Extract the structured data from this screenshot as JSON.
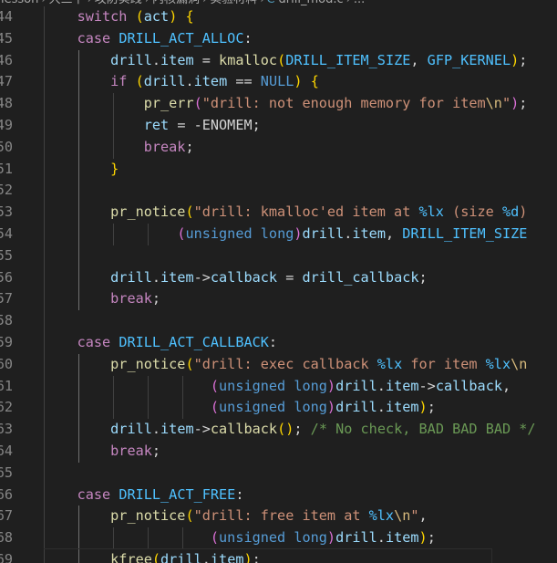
{
  "breadcrumb": [
    "lesson",
    "大三下",
    "攻防实践",
    "内核漏洞",
    "实验材料",
    "drill_mod.c",
    "..."
  ],
  "lines": [
    {
      "n": "44",
      "g": 1,
      "t": [
        [
          "",
          "    "
        ],
        [
          "ctl",
          "switch"
        ],
        [
          "pl",
          " "
        ],
        [
          "p1",
          "("
        ],
        [
          "var",
          "act"
        ],
        [
          "p1",
          ")"
        ],
        [
          "pl",
          " "
        ],
        [
          "p1",
          "{"
        ]
      ]
    },
    {
      "n": "45",
      "g": 1,
      "t": [
        [
          "",
          "    "
        ],
        [
          "ctl",
          "case"
        ],
        [
          "pl",
          " "
        ],
        [
          "mac",
          "DRILL_ACT_ALLOC"
        ],
        [
          "pl",
          ":"
        ]
      ]
    },
    {
      "n": "46",
      "g": 2,
      "t": [
        [
          "",
          "        "
        ],
        [
          "var",
          "drill"
        ],
        [
          "pl",
          "."
        ],
        [
          "var",
          "item"
        ],
        [
          "pl",
          " = "
        ],
        [
          "fn",
          "kmalloc"
        ],
        [
          "p1",
          "("
        ],
        [
          "mac",
          "DRILL_ITEM_SIZE"
        ],
        [
          "pl",
          ", "
        ],
        [
          "mac",
          "GFP_KERNEL"
        ],
        [
          "p1",
          ")"
        ],
        [
          "pl",
          ";"
        ]
      ]
    },
    {
      "n": "47",
      "g": 2,
      "t": [
        [
          "",
          "        "
        ],
        [
          "ctl",
          "if"
        ],
        [
          "pl",
          " "
        ],
        [
          "p1",
          "("
        ],
        [
          "var",
          "drill"
        ],
        [
          "pl",
          "."
        ],
        [
          "var",
          "item"
        ],
        [
          "pl",
          " == "
        ],
        [
          "kw",
          "NULL"
        ],
        [
          "p1",
          ")"
        ],
        [
          "pl",
          " "
        ],
        [
          "p1",
          "{"
        ]
      ]
    },
    {
      "n": "48",
      "g": 3,
      "t": [
        [
          "",
          "            "
        ],
        [
          "fn",
          "pr_err"
        ],
        [
          "p2",
          "("
        ],
        [
          "str",
          "\"drill: not enough memory for item"
        ],
        [
          "esc",
          "\\n"
        ],
        [
          "str",
          "\""
        ],
        [
          "p2",
          ")"
        ],
        [
          "pl",
          ";"
        ]
      ]
    },
    {
      "n": "49",
      "g": 3,
      "t": [
        [
          "",
          "            "
        ],
        [
          "var",
          "ret"
        ],
        [
          "pl",
          " = -ENOMEM;"
        ]
      ]
    },
    {
      "n": "50",
      "g": 3,
      "t": [
        [
          "",
          "            "
        ],
        [
          "ctl",
          "break"
        ],
        [
          "pl",
          ";"
        ]
      ]
    },
    {
      "n": "51",
      "g": 2,
      "t": [
        [
          "",
          "        "
        ],
        [
          "p1",
          "}"
        ]
      ]
    },
    {
      "n": "52",
      "g": 2,
      "t": [
        [
          "",
          ""
        ]
      ]
    },
    {
      "n": "53",
      "g": 2,
      "t": [
        [
          "",
          "        "
        ],
        [
          "fn",
          "pr_notice"
        ],
        [
          "p1",
          "("
        ],
        [
          "str",
          "\"drill: kmalloc'ed item at "
        ],
        [
          "mac",
          "%lx"
        ],
        [
          "str",
          " (size "
        ],
        [
          "mac",
          "%d"
        ],
        [
          "str",
          ")"
        ]
      ]
    },
    {
      "n": "54",
      "g": 4,
      "t": [
        [
          "",
          "                "
        ],
        [
          "p2",
          "("
        ],
        [
          "kw",
          "unsigned"
        ],
        [
          "pl",
          " "
        ],
        [
          "kw",
          "long"
        ],
        [
          "p2",
          ")"
        ],
        [
          "var",
          "drill"
        ],
        [
          "pl",
          "."
        ],
        [
          "var",
          "item"
        ],
        [
          "pl",
          ", "
        ],
        [
          "mac",
          "DRILL_ITEM_SIZE"
        ]
      ]
    },
    {
      "n": "55",
      "g": 2,
      "t": [
        [
          "",
          ""
        ]
      ]
    },
    {
      "n": "56",
      "g": 2,
      "t": [
        [
          "",
          "        "
        ],
        [
          "var",
          "drill"
        ],
        [
          "pl",
          "."
        ],
        [
          "var",
          "item"
        ],
        [
          "pl",
          "->"
        ],
        [
          "var",
          "callback"
        ],
        [
          "pl",
          " = "
        ],
        [
          "var",
          "drill_callback"
        ],
        [
          "pl",
          ";"
        ]
      ]
    },
    {
      "n": "57",
      "g": 2,
      "t": [
        [
          "",
          "        "
        ],
        [
          "ctl",
          "break"
        ],
        [
          "pl",
          ";"
        ]
      ]
    },
    {
      "n": "58",
      "g": 1,
      "t": [
        [
          "",
          ""
        ]
      ]
    },
    {
      "n": "59",
      "g": 1,
      "t": [
        [
          "",
          "    "
        ],
        [
          "ctl",
          "case"
        ],
        [
          "pl",
          " "
        ],
        [
          "mac",
          "DRILL_ACT_CALLBACK"
        ],
        [
          "pl",
          ":"
        ]
      ]
    },
    {
      "n": "60",
      "g": 2,
      "t": [
        [
          "",
          "        "
        ],
        [
          "fn",
          "pr_notice"
        ],
        [
          "p1",
          "("
        ],
        [
          "str",
          "\"drill: exec callback "
        ],
        [
          "mac",
          "%lx"
        ],
        [
          "str",
          " for item "
        ],
        [
          "mac",
          "%lx"
        ],
        [
          "esc",
          "\\n"
        ]
      ]
    },
    {
      "n": "61",
      "g": 5,
      "t": [
        [
          "",
          "                    "
        ],
        [
          "p2",
          "("
        ],
        [
          "kw",
          "unsigned"
        ],
        [
          "pl",
          " "
        ],
        [
          "kw",
          "long"
        ],
        [
          "p2",
          ")"
        ],
        [
          "var",
          "drill"
        ],
        [
          "pl",
          "."
        ],
        [
          "var",
          "item"
        ],
        [
          "pl",
          "->"
        ],
        [
          "var",
          "callback"
        ],
        [
          "pl",
          ","
        ]
      ]
    },
    {
      "n": "62",
      "g": 5,
      "t": [
        [
          "",
          "                    "
        ],
        [
          "p2",
          "("
        ],
        [
          "kw",
          "unsigned"
        ],
        [
          "pl",
          " "
        ],
        [
          "kw",
          "long"
        ],
        [
          "p2",
          ")"
        ],
        [
          "var",
          "drill"
        ],
        [
          "pl",
          "."
        ],
        [
          "var",
          "item"
        ],
        [
          "p1",
          ")"
        ],
        [
          "pl",
          ";"
        ]
      ]
    },
    {
      "n": "63",
      "g": 2,
      "t": [
        [
          "",
          "        "
        ],
        [
          "var",
          "drill"
        ],
        [
          "pl",
          "."
        ],
        [
          "var",
          "item"
        ],
        [
          "pl",
          "->"
        ],
        [
          "fn",
          "callback"
        ],
        [
          "p1",
          "("
        ],
        [
          "p1",
          ")"
        ],
        [
          "pl",
          "; "
        ],
        [
          "cm",
          "/* No check, BAD BAD BAD */"
        ]
      ]
    },
    {
      "n": "64",
      "g": 2,
      "t": [
        [
          "",
          "        "
        ],
        [
          "ctl",
          "break"
        ],
        [
          "pl",
          ";"
        ]
      ]
    },
    {
      "n": "65",
      "g": 1,
      "t": [
        [
          "",
          ""
        ]
      ]
    },
    {
      "n": "66",
      "g": 1,
      "t": [
        [
          "",
          "    "
        ],
        [
          "ctl",
          "case"
        ],
        [
          "pl",
          " "
        ],
        [
          "mac",
          "DRILL_ACT_FREE"
        ],
        [
          "pl",
          ":"
        ]
      ]
    },
    {
      "n": "67",
      "g": 2,
      "t": [
        [
          "",
          "        "
        ],
        [
          "fn",
          "pr_notice"
        ],
        [
          "p1",
          "("
        ],
        [
          "str",
          "\"drill: free item at "
        ],
        [
          "mac",
          "%lx"
        ],
        [
          "esc",
          "\\n"
        ],
        [
          "str",
          "\""
        ],
        [
          "pl",
          ","
        ]
      ]
    },
    {
      "n": "68",
      "g": 5,
      "t": [
        [
          "",
          "                    "
        ],
        [
          "p2",
          "("
        ],
        [
          "kw",
          "unsigned"
        ],
        [
          "pl",
          " "
        ],
        [
          "kw",
          "long"
        ],
        [
          "p2",
          ")"
        ],
        [
          "var",
          "drill"
        ],
        [
          "pl",
          "."
        ],
        [
          "var",
          "item"
        ],
        [
          "p1",
          ")"
        ],
        [
          "pl",
          ";"
        ]
      ]
    },
    {
      "n": "69",
      "g": 2,
      "cursor": true,
      "t": [
        [
          "",
          "        "
        ],
        [
          "fn",
          "kfree"
        ],
        [
          "p1",
          "("
        ],
        [
          "var",
          "drill"
        ],
        [
          "pl",
          "."
        ],
        [
          "var",
          "item"
        ],
        [
          "p1",
          ")"
        ],
        [
          "pl",
          ";"
        ]
      ]
    }
  ],
  "colors": {
    "background": "#1f1f1f",
    "keyword": "#569cd6",
    "control": "#c586c0",
    "function": "#dcdcaa",
    "string": "#ce9178",
    "variable": "#9cdcfe",
    "macro": "#4fc1ff",
    "comment": "#6a9955"
  }
}
